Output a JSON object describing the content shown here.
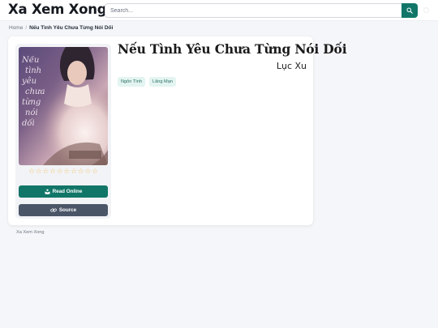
{
  "header": {
    "brand": "Xa Xem Xong",
    "search_placeholder": "Search...",
    "search_icon": "search-icon",
    "theme_icon": "sun-icon"
  },
  "breadcrumb": {
    "home": "Home",
    "separator": "/",
    "current": "Nếu Tình Yêu Chưa Từng Nói Dối"
  },
  "book": {
    "title": "Nếu Tình Yêu Chưa Từng Nói Dối",
    "author": "Lục Xu",
    "tags": [
      "Ngôn Tình",
      "Lãng Mạn"
    ],
    "rating": 0,
    "max_rating": 10,
    "cover_text": [
      "Nếu",
      "tình",
      "yêu",
      "chưa",
      "từng",
      "nói",
      "dối"
    ]
  },
  "actions": {
    "read_label": "Read Online",
    "read_icon": "book-reader-icon",
    "source_label": "Source",
    "source_icon": "link-icon"
  },
  "footer": {
    "text": "Xa Xem Xong"
  },
  "colors": {
    "primary": "#117668",
    "secondary": "#4a5568",
    "star": "#efc26a",
    "tag_bg": "#e3f4f1",
    "tag_text": "#2b6e65"
  }
}
